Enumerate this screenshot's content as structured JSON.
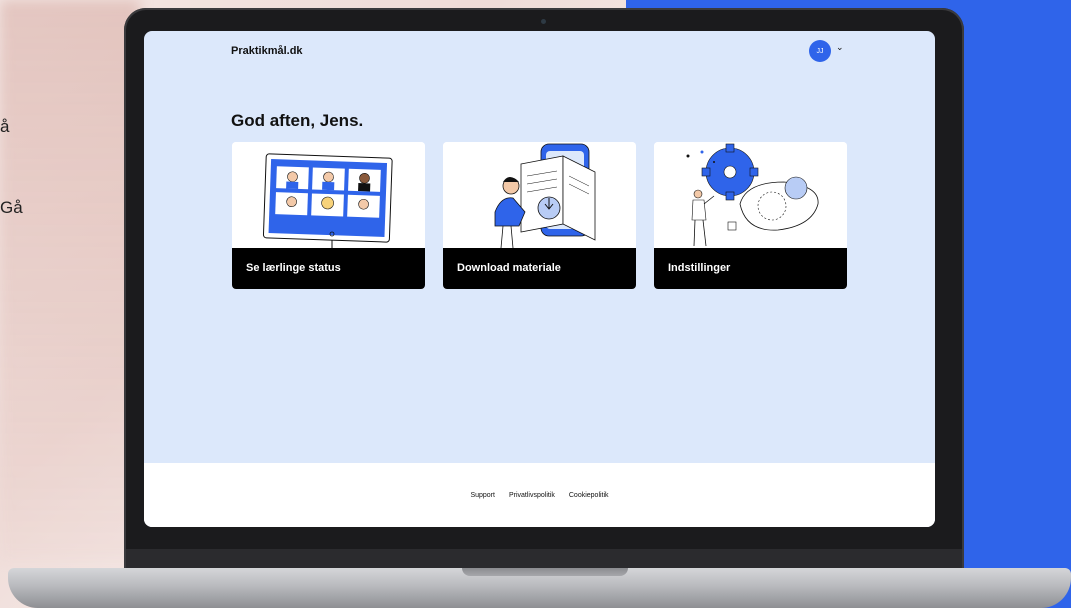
{
  "backdrop": {
    "side_text_1": "å",
    "side_text_2": "Gå",
    "accent_color": "#2f64ea"
  },
  "app": {
    "brand": "Praktikmål.dk",
    "user_initials": "JJ",
    "greeting": "God aften, Jens."
  },
  "cards": [
    {
      "label": "Se lærlinge status",
      "icon": "video-call-illustration"
    },
    {
      "label": "Download materiale",
      "icon": "download-book-illustration"
    },
    {
      "label": "Indstillinger",
      "icon": "settings-gear-illustration"
    }
  ],
  "footer": {
    "links": [
      "Support",
      "Privatlivspolitik",
      "Cookiepolitik"
    ]
  }
}
